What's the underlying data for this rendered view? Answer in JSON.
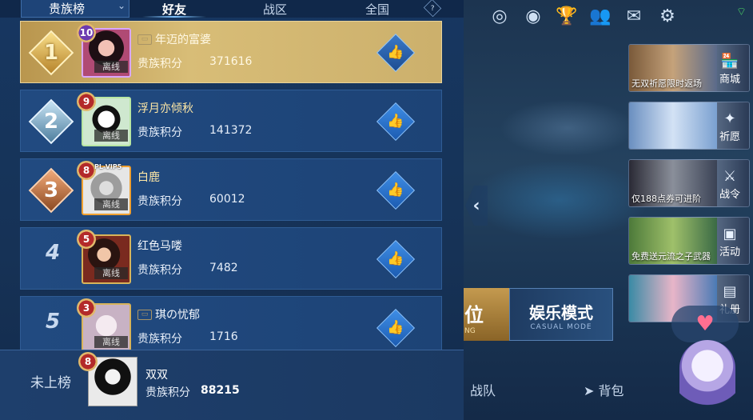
{
  "tabs": {
    "rank_select": "贵族榜",
    "friends": "好友",
    "zone": "战区",
    "all": "全国"
  },
  "rows": [
    {
      "rank": "1",
      "level": "10",
      "name": "年迈的富婆",
      "status": "离线",
      "score_label": "贵族积分",
      "score": "371616",
      "badge": "gold"
    },
    {
      "rank": "2",
      "level": "9",
      "name": "浮月亦倾秋",
      "status": "离线",
      "score_label": "贵族积分",
      "score": "141372",
      "badge": "silver"
    },
    {
      "rank": "3",
      "level": "8",
      "name": "白鹿",
      "status": "离线",
      "score_label": "贵族积分",
      "score": "60012",
      "badge": "bronze",
      "tag": "PL-VIP5"
    },
    {
      "rank": "4",
      "level": "5",
      "name": "红色马喽",
      "status": "离线",
      "score_label": "贵族积分",
      "score": "7482",
      "badge": "none"
    },
    {
      "rank": "5",
      "level": "3",
      "name": "琪の忧郁",
      "status": "离线",
      "score_label": "贵族积分",
      "score": "1716",
      "badge": "none"
    }
  ],
  "me": {
    "status": "未上榜",
    "level": "8",
    "name": "双双",
    "score_label": "贵族积分",
    "score": "88215"
  },
  "side_menu": [
    {
      "caption": "无双祈愿限时返场",
      "action": "商城",
      "icon": "shop-icon"
    },
    {
      "caption": "",
      "action": "祈愿",
      "icon": "wish-icon"
    },
    {
      "caption": "仅188点券可进阶",
      "action": "战令",
      "icon": "battle-pass-icon"
    },
    {
      "caption": "免费送元流之子武器",
      "action": "活动",
      "icon": "event-icon"
    },
    {
      "caption": "",
      "action": "礼册",
      "icon": "gift-book-icon"
    }
  ],
  "modes": {
    "ranked_fragment": "位",
    "ranked_sub": "NG",
    "casual": "娱乐模式",
    "casual_sub": "CASUAL MODE"
  },
  "bottom_bar": {
    "team": "战队",
    "bag": "背包"
  },
  "colors": {
    "panel_bg": "#173761",
    "gold_row": "#d8bd77",
    "like_button": "#3f8ee6"
  }
}
